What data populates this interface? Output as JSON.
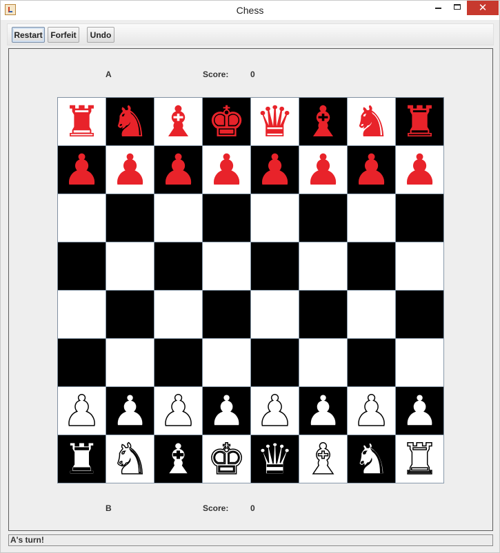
{
  "window": {
    "title": "Chess",
    "close_glyph": "✕"
  },
  "toolbar": {
    "restart_label": "Restart",
    "forfeit_label": "Forfeit",
    "undo_label": "Undo"
  },
  "top_player": {
    "name": "A",
    "score_label": "Score:",
    "score": "0"
  },
  "bottom_player": {
    "name": "B",
    "score_label": "Score:",
    "score": "0"
  },
  "status": "A's turn!",
  "colors": {
    "red_pieces": "#e8232a",
    "white_pieces": "#ffffff",
    "dark_square": "#000000",
    "light_square": "#ffffff",
    "close_button": "#c7392e"
  },
  "board": {
    "first_square": "light",
    "rows": [
      [
        [
          "rook",
          "red"
        ],
        [
          "knight",
          "red"
        ],
        [
          "bishop",
          "red"
        ],
        [
          "king",
          "red"
        ],
        [
          "queen",
          "red"
        ],
        [
          "bishop",
          "red"
        ],
        [
          "knight",
          "red"
        ],
        [
          "rook",
          "red"
        ]
      ],
      [
        [
          "pawn",
          "red"
        ],
        [
          "pawn",
          "red"
        ],
        [
          "pawn",
          "red"
        ],
        [
          "pawn",
          "red"
        ],
        [
          "pawn",
          "red"
        ],
        [
          "pawn",
          "red"
        ],
        [
          "pawn",
          "red"
        ],
        [
          "pawn",
          "red"
        ]
      ],
      [
        null,
        null,
        null,
        null,
        null,
        null,
        null,
        null
      ],
      [
        null,
        null,
        null,
        null,
        null,
        null,
        null,
        null
      ],
      [
        null,
        null,
        null,
        null,
        null,
        null,
        null,
        null
      ],
      [
        null,
        null,
        null,
        null,
        null,
        null,
        null,
        null
      ],
      [
        [
          "pawn",
          "white"
        ],
        [
          "pawn",
          "white"
        ],
        [
          "pawn",
          "white"
        ],
        [
          "pawn",
          "white"
        ],
        [
          "pawn",
          "white"
        ],
        [
          "pawn",
          "white"
        ],
        [
          "pawn",
          "white"
        ],
        [
          "pawn",
          "white"
        ]
      ],
      [
        [
          "rook",
          "white"
        ],
        [
          "knight",
          "white"
        ],
        [
          "bishop",
          "white"
        ],
        [
          "king",
          "white"
        ],
        [
          "queen",
          "white"
        ],
        [
          "bishop",
          "white"
        ],
        [
          "knight",
          "white"
        ],
        [
          "rook",
          "white"
        ]
      ]
    ]
  }
}
